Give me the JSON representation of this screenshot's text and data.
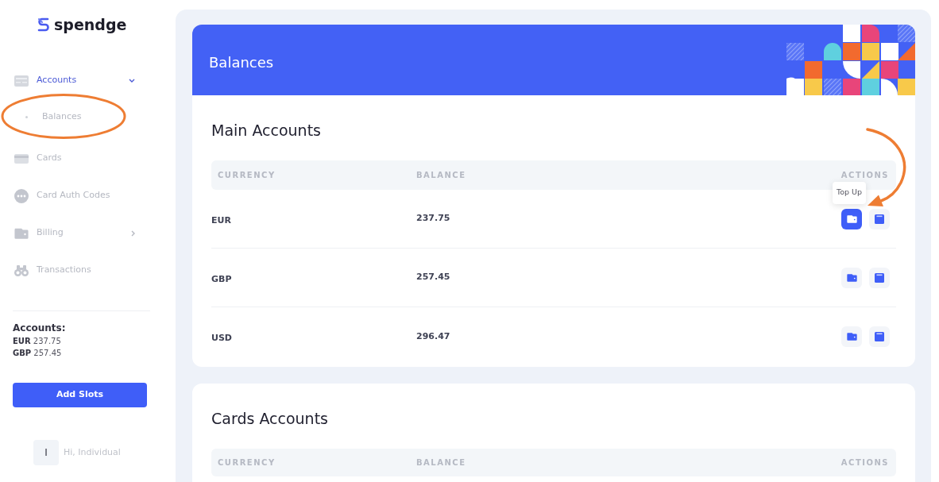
{
  "logo": {
    "text": "spendge"
  },
  "sidebar": {
    "items": [
      {
        "kind": "group",
        "label": "Accounts",
        "selected": true,
        "expanded": true,
        "children": [
          {
            "label": "Balances",
            "selected": false,
            "annotation": {
              "kind": "ellipse"
            }
          }
        ]
      },
      {
        "kind": "link",
        "label": "Cards",
        "selected": false
      },
      {
        "kind": "link",
        "label": "Card Auth Codes",
        "selected": false
      },
      {
        "kind": "group",
        "label": "Billing",
        "selected": false,
        "expanded": false
      },
      {
        "kind": "link",
        "label": "Transactions",
        "selected": false
      }
    ],
    "summary": {
      "title": "Accounts:",
      "entries": [
        {
          "currency": "EUR",
          "amount": "237.75"
        },
        {
          "currency": "GBP",
          "amount": "257.45"
        }
      ]
    },
    "button": "Add Slots",
    "user": {
      "initial": "I",
      "greeting": "Hi, Individual"
    }
  },
  "page": {
    "title": "Balances",
    "sections": [
      {
        "title": "Main Accounts",
        "columns": [
          "CURRENCY",
          "BALANCE",
          "ACTIONS"
        ],
        "rows": [
          {
            "currency": "EUR",
            "balance": "237.75",
            "actions": [
              {
                "kind": "top_up",
                "hovered": true,
                "tooltip": "Top Up",
                "annotation": {
                  "kind": "arrow"
                }
              },
              {
                "kind": "secondary",
                "hovered": false
              }
            ]
          },
          {
            "currency": "GBP",
            "balance": "257.45",
            "actions": [
              {
                "kind": "top_up",
                "hovered": false
              },
              {
                "kind": "secondary",
                "hovered": false
              }
            ]
          },
          {
            "currency": "USD",
            "balance": "296.47",
            "actions": [
              {
                "kind": "top_up",
                "hovered": false
              },
              {
                "kind": "secondary",
                "hovered": false
              }
            ]
          }
        ]
      },
      {
        "title": "Cards Accounts",
        "columns": [
          "CURRENCY",
          "BALANCE",
          "ACTIONS"
        ]
      }
    ]
  }
}
